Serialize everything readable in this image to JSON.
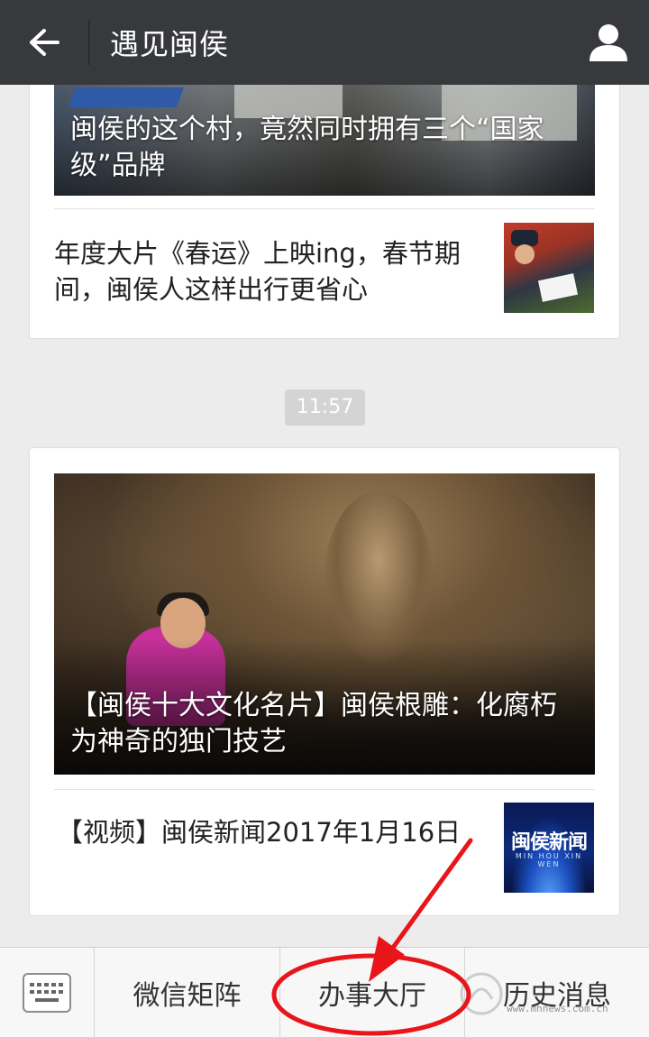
{
  "header": {
    "title": "遇见闽侯",
    "back_icon": "arrow-left-icon",
    "profile_icon": "user-icon"
  },
  "feed": {
    "message1": {
      "cover_title": "闽侯的这个村，竟然同时拥有三个“国家级”品牌",
      "article": "年度大片《春运》上映ing，春节期间，闽侯人这样出行更省心"
    },
    "timestamp": "11:57",
    "message2": {
      "cover_title": "【闽侯十大文化名片】闽侯根雕：化腐朽为神奇的独门技艺",
      "article": "【视频】闽侯新闻2017年1月16日",
      "thumb_brand": "闽侯新闻",
      "thumb_sub": "MIN HOU XIN WEN"
    }
  },
  "menu": {
    "keyboard_icon": "keyboard-icon",
    "items": [
      "微信矩阵",
      "办事大厅",
      "历史消息"
    ]
  },
  "watermark": "www.mhnews.com.cn",
  "colors": {
    "header_bg": "#37393c",
    "page_bg": "#ececec",
    "annotation": "#e8151b"
  }
}
